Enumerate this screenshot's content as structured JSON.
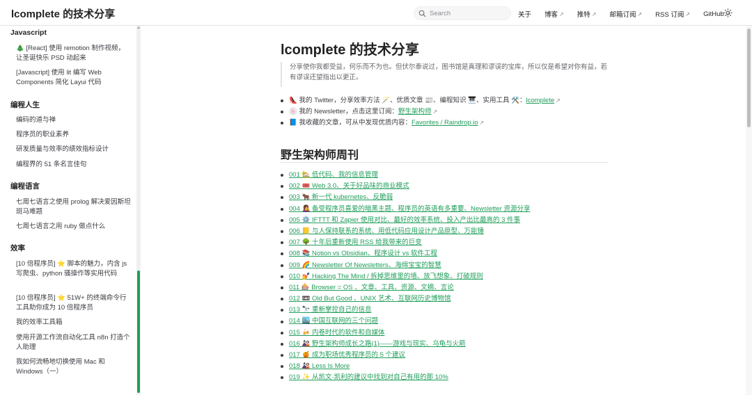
{
  "header": {
    "title": "lcomplete 的技术分享",
    "search_placeholder": "Search",
    "nav": [
      {
        "label": "关于",
        "external": false
      },
      {
        "label": "博客",
        "external": true
      },
      {
        "label": "推特",
        "external": true
      },
      {
        "label": "邮箱订阅",
        "external": true
      },
      {
        "label": "RSS 订阅",
        "external": true
      },
      {
        "label": "GitHub",
        "external": true
      }
    ],
    "theme_icon": "sun-icon"
  },
  "sidebar": {
    "groups": [
      {
        "title": "Javascript",
        "items": [
          "🎄 [React] 使用 remotion 制作视频，让圣诞快乐 PSD 动起来",
          "[Javascript] 使用 lit 编写 Web Components 简化 Layui 代码"
        ]
      },
      {
        "title": "编程人生",
        "items": [
          "编码的道与禅",
          "程序员的职业素养",
          "研发质量与效率的绩效指标设计",
          "编程界的 51 条名言佳句"
        ]
      },
      {
        "title": "编程语言",
        "items": [
          "七周七语言之使用 prolog 解决爱因斯坦斑马难题",
          "七周七语言之用 ruby 做点什么"
        ]
      },
      {
        "title": "效率",
        "items": [
          "[10 倍程序员] ⭐ 脚本的魅力，内含 js 写爬虫、python 骚操作等实用代码",
          "[10 倍程序员] ⭐ 51W+ 的终端命令行工具助你成为 10 倍程序员",
          "我的效率工具箱",
          "使用开源工作流自动化工具 n8n 打造个人助理",
          "我如何流畅地切换使用 Mac 和 Windows（一）"
        ]
      }
    ]
  },
  "main": {
    "title": "lcomplete 的技术分享",
    "quote": "分享使你我都受益，何乐而不为也。但伏尔泰说过，图书馆是真理和谬误的宝库，所以仅是希望对你有益，若有谬误还望指出以更正。",
    "intro": [
      {
        "text": "👠 我的 Twitter，分享效率方法 🪄、优质文章 📰、编程知识 🎹、实用工具 🛠️：",
        "link": "lcomplete"
      },
      {
        "text": "🍥 我的 Newsletter，点击这里订阅：",
        "link": "野生架构师"
      },
      {
        "text": "📘 我收藏的文章，可从中发现优质内容：",
        "link": "Favorites / Raindrop.io"
      }
    ],
    "section_title": "野生架构师周刊",
    "issues": [
      "001 🏡 低代码、我的信息管理",
      "002 🎟️ Web 3.0、关于好品味的商业模式",
      "003 🐂 新一代 kubernetes、反脆弱",
      "004 👩‍🎤 备受程序员喜爱的暗黑主题、程序员的英语有多重要、Newsletter 资源分享",
      "005 ⚙️ IFTTT 和 Zapier 使用对比、最好的效率系统、投入产出比最高的 3 件事",
      "006 📒 与人保持联系的系统、用低代码应用设计产品原型、万能锤",
      "007 🌳 十年后重新使用 RSS 给我带来的巨变",
      "008 📚 Notion vs Obsidian、程序设计 vs 软件工程",
      "009 🌈 Newsletter Of Newsletters、海绵宝宝的智慧",
      "010 💅 Hacking The Mind / 拆掉思维里的墙、放飞想象、打破规则",
      "011 🎰 Browser = OS 、文章、工具、资源、文摘、言论",
      "012 📼 Old But Good 、UNIX 艺术、互联网历史博物馆",
      "013 🔭 重新掌控自己的信息",
      "014 🏙️ 中国互联网的三个问题",
      "015 🍻 内卷时代的软件和自媒体",
      "016 🎎 野生架构师成长之路(1)——游戏与现实、乌龟与火箭",
      "017 🍯 成为职场优秀程序员的 5 个建议",
      "018 🎎 Less Is More",
      "019 ✨ 从凯文·凯利的建议中找到对自己有用的那 10%"
    ]
  },
  "colors": {
    "accent": "#1f9d5a",
    "text": "#3c3c43",
    "divider": "#e2e2e3"
  }
}
